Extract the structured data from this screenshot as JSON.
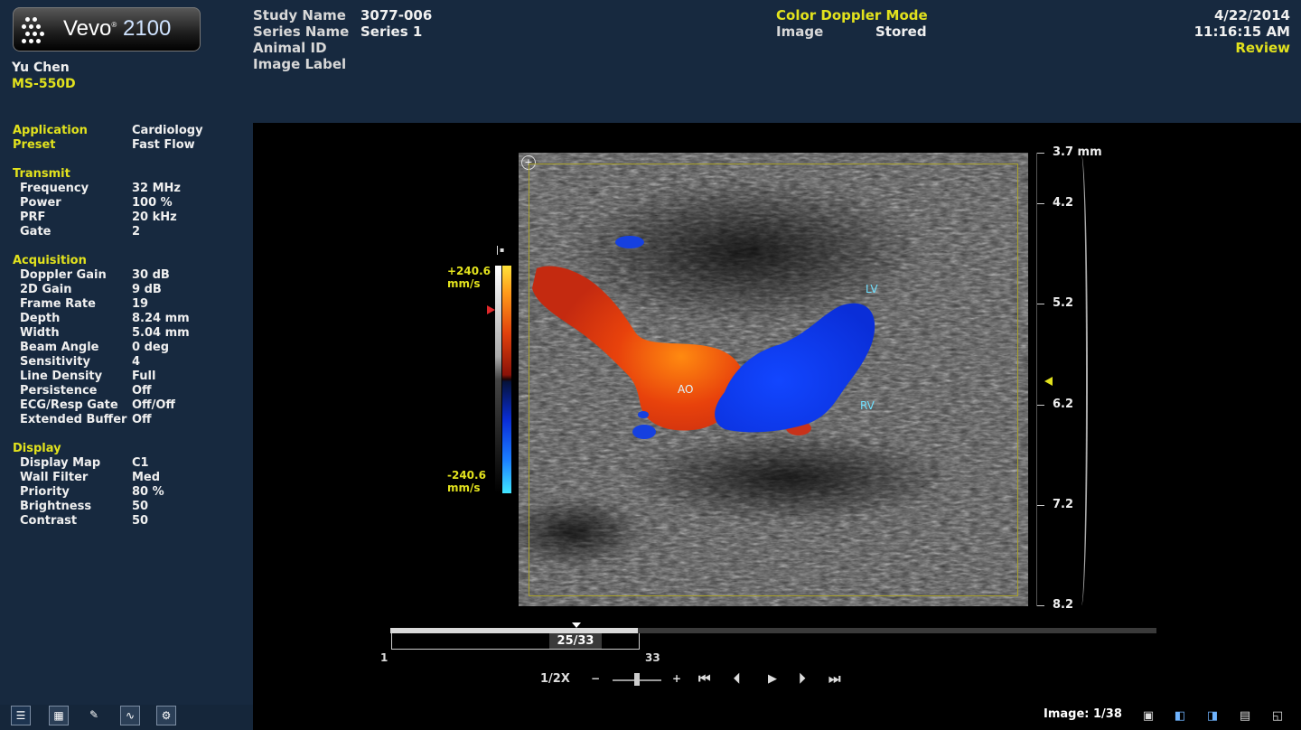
{
  "brand": {
    "name": "Vevo",
    "model": "2100"
  },
  "user": {
    "name": "Yu Chen",
    "transducer": "MS-550D"
  },
  "header": {
    "study_name_label": "Study Name",
    "study_name_value": "3077-006",
    "series_name_label": "Series Name",
    "series_name_value": "Series 1",
    "animal_id_label": "Animal ID",
    "image_label_label": "Image Label",
    "mode": "Color Doppler Mode",
    "image_label": "Image",
    "image_value": "Stored",
    "date": "4/22/2014",
    "time": "11:16:15 AM",
    "status": "Review"
  },
  "settings": {
    "application_label": "Application",
    "application_value": "Cardiology",
    "preset_label": "Preset",
    "preset_value": "Fast Flow",
    "sections": [
      {
        "title": "Transmit",
        "items": [
          {
            "label": "Frequency",
            "value": "32 MHz"
          },
          {
            "label": "Power",
            "value": "100 %"
          },
          {
            "label": "PRF",
            "value": "20 kHz"
          },
          {
            "label": "Gate",
            "value": "2"
          }
        ]
      },
      {
        "title": "Acquisition",
        "items": [
          {
            "label": "Doppler Gain",
            "value": "30 dB"
          },
          {
            "label": "2D Gain",
            "value": "9 dB"
          },
          {
            "label": "Frame Rate",
            "value": "19"
          },
          {
            "label": "Depth",
            "value": "8.24 mm"
          },
          {
            "label": "Width",
            "value": "5.04 mm"
          },
          {
            "label": "Beam Angle",
            "value": "0 deg"
          },
          {
            "label": "Sensitivity",
            "value": "4"
          },
          {
            "label": "Line Density",
            "value": "Full"
          },
          {
            "label": "Persistence",
            "value": "Off"
          },
          {
            "label": "ECG/Resp Gate",
            "value": "Off/Off"
          },
          {
            "label": "Extended Buffer",
            "value": "Off"
          }
        ]
      },
      {
        "title": "Display",
        "items": [
          {
            "label": "Display Map",
            "value": "C1"
          },
          {
            "label": "Wall Filter",
            "value": "Med"
          },
          {
            "label": "Priority",
            "value": "80 %"
          },
          {
            "label": "Brightness",
            "value": "50"
          },
          {
            "label": "Contrast",
            "value": "50"
          }
        ]
      }
    ]
  },
  "velocity_scale": {
    "top_value": "+240.6",
    "bottom_value": "-240.6",
    "unit": "mm/s"
  },
  "depth_scale": {
    "labels": [
      "3.7 mm",
      "4.2",
      "5.2",
      "6.2",
      "7.2",
      "8.2"
    ]
  },
  "annotations": {
    "lv": "LV",
    "ao": "AO",
    "rv": "RV"
  },
  "timeline": {
    "frame_display": "25/33",
    "start": "1",
    "end": "33",
    "current_frame": 25,
    "total_frames": 33
  },
  "playback": {
    "speed": "1/2X",
    "minus": "−",
    "plus": "+",
    "first": "⏮",
    "prev": "⏴",
    "play": "▶",
    "next": "⏵",
    "last": "⏭"
  },
  "footer": {
    "image_count": "Image: 1/38"
  }
}
